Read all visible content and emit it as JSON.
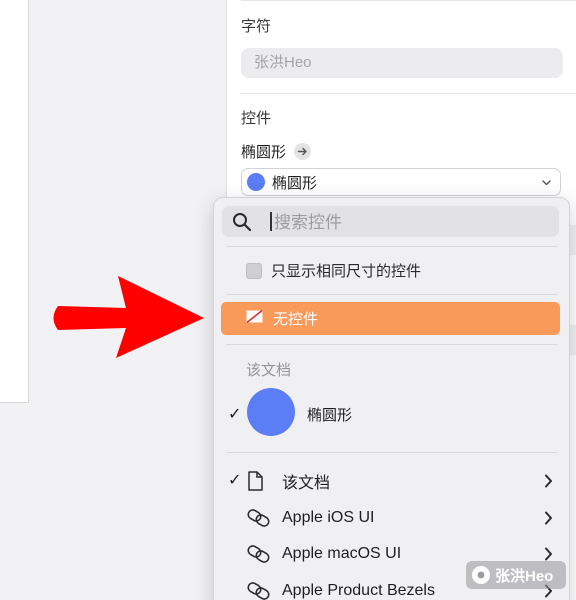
{
  "inspector": {
    "characters_title": "字符",
    "characters_placeholder": "张洪Heo",
    "controls_title": "控件",
    "control_name": "椭圆形",
    "selected_control": "椭圆形",
    "selected_color": "#5b7df5"
  },
  "popup": {
    "search_placeholder": "搜索控件",
    "same_size_only_label": "只显示相同尺寸的控件",
    "same_size_only_checked": false,
    "no_control_label": "无控件",
    "highlight_color": "#fa9a5a",
    "document_group_header": "该文档",
    "document_symbol": {
      "label": "椭圆形",
      "checked": true,
      "color": "#5b7df5"
    },
    "libraries": [
      {
        "label": "该文档",
        "icon": "document-icon",
        "checked": true
      },
      {
        "label": "Apple iOS UI",
        "icon": "link-icon",
        "checked": false
      },
      {
        "label": "Apple macOS UI",
        "icon": "link-icon",
        "checked": false
      },
      {
        "label": "Apple Product Bezels",
        "icon": "link-icon",
        "checked": false
      }
    ]
  },
  "annotation": {
    "arrow_color": "#ff0000"
  },
  "watermark": {
    "text": "张洪Heo"
  }
}
